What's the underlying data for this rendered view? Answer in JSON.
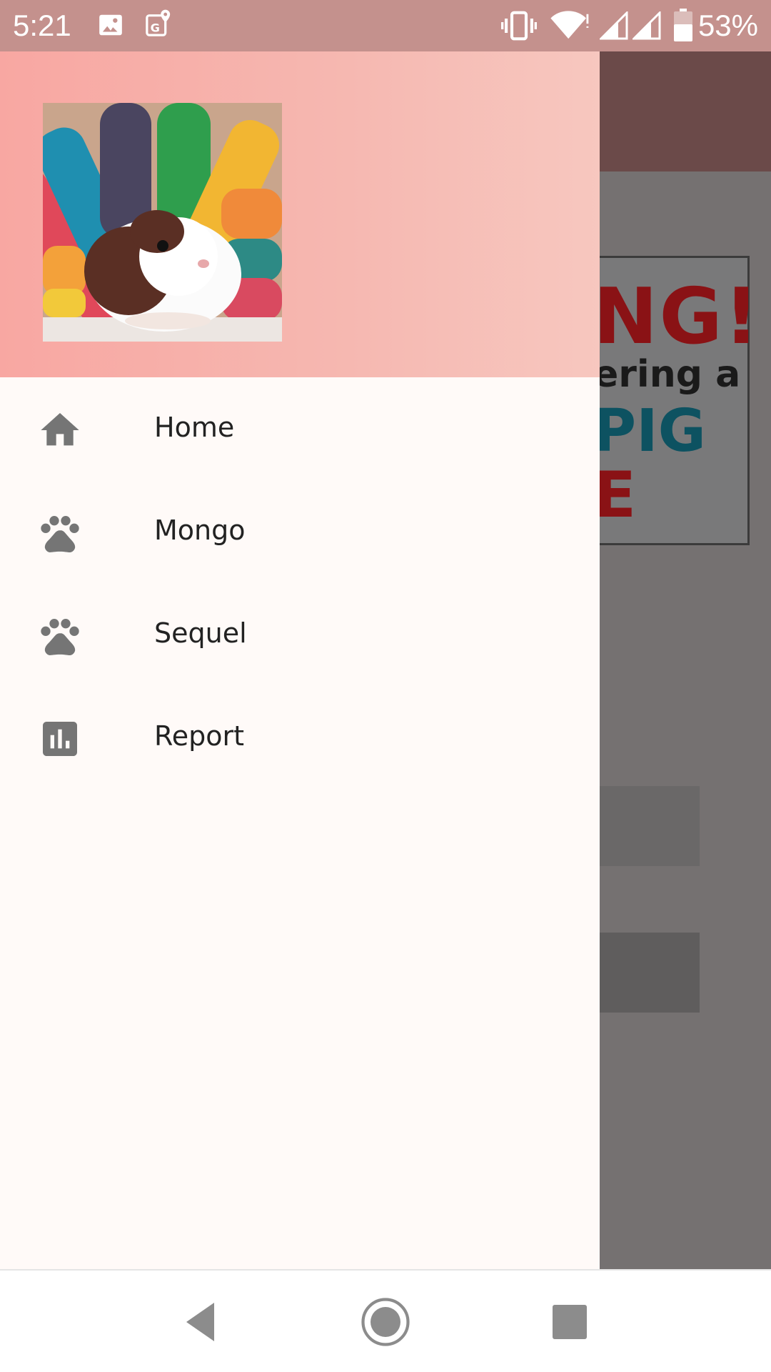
{
  "status_bar": {
    "time": "5:21",
    "battery_percent": "53%",
    "icons": [
      "image-notification-icon",
      "maps-notification-icon",
      "vibrate-icon",
      "wifi-icon",
      "signal-sim1-icon",
      "signal-sim2-icon",
      "battery-icon"
    ]
  },
  "drawer": {
    "header": {
      "avatar": "guinea-pig-photo"
    },
    "items": [
      {
        "label": "Home",
        "icon": "home-icon"
      },
      {
        "label": "Mongo",
        "icon": "paw-icon"
      },
      {
        "label": "Sequel",
        "icon": "paw-icon"
      },
      {
        "label": "Report",
        "icon": "bar-chart-icon"
      }
    ]
  },
  "background_app": {
    "poster_lines": [
      "NG!",
      "ering a",
      "PIG",
      "E"
    ]
  },
  "nav_bar": {
    "buttons": [
      "back-icon",
      "home-circle-icon",
      "recents-icon"
    ]
  },
  "colors": {
    "status_bar": "#c4918d",
    "drawer_header_start": "#f8a7a2",
    "drawer_header_end": "#f7c7bf",
    "drawer_bg": "#fffaf8",
    "icon_gray": "#757575",
    "label": "#222222"
  }
}
